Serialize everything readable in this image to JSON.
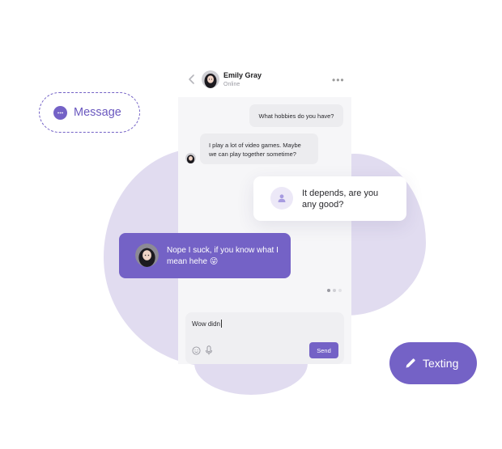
{
  "colors": {
    "accent": "#7462c6",
    "blob": "#e1dcf0",
    "phone_bg": "#f6f6f8",
    "bubble_gray": "#ececef"
  },
  "chat": {
    "contact_name": "Emily Gray",
    "contact_status": "Online",
    "back_icon": "chevron-left-icon",
    "more_icon": "more-horizontal-icon"
  },
  "messages": [
    {
      "text": "What hobbies do you have?",
      "direction": "outgoing"
    },
    {
      "text": "I play a lot of video games. Maybe we can play together sometime?",
      "direction": "incoming"
    },
    {
      "text": "It depends, are you any good?",
      "direction": "outgoing"
    },
    {
      "text": "Nope I suck, if you know what I mean hehe 😜",
      "direction": "incoming"
    }
  ],
  "pagination": {
    "count": 3,
    "active_index": 0
  },
  "composer": {
    "input_value": "Wow didn",
    "send_label": "Send",
    "emoji_icon": "smile-icon",
    "mic_icon": "microphone-icon"
  },
  "badges": {
    "message_label": "Message",
    "message_icon": "chat-bubble-icon",
    "texting_label": "Texting",
    "texting_icon": "pencil-icon"
  }
}
